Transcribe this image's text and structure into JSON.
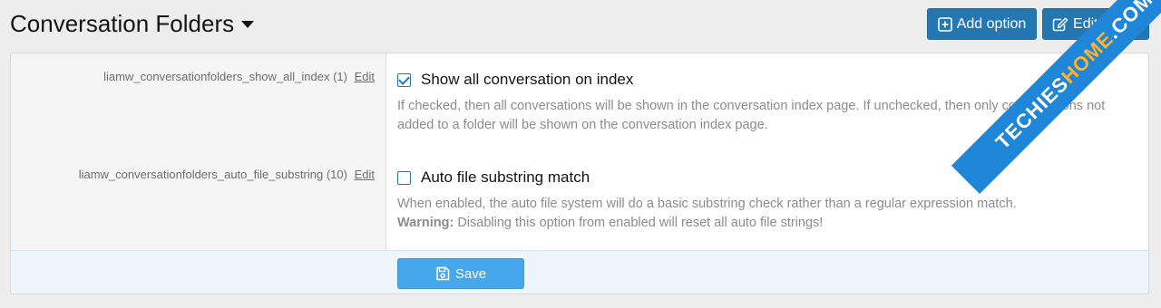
{
  "header": {
    "title": "Conversation Folders",
    "add_option_label": "Add option",
    "edit_group_label": "Edit group"
  },
  "options": [
    {
      "key": "liamw_conversationfolders_show_all_index (1)",
      "edit_label": "Edit",
      "checked": true,
      "title": "Show all conversation on index",
      "description": "If checked, then all conversations will be shown in the conversation index page. If unchecked, then only conversations not added to a folder will be shown on the conversation index page."
    },
    {
      "key": "liamw_conversationfolders_auto_file_substring (10)",
      "edit_label": "Edit",
      "checked": false,
      "title": "Auto file substring match",
      "description": "When enabled, the auto file system will do a basic substring check rather than a regular expression match.",
      "warning_label": "Warning:",
      "warning_text": "Disabling this option from enabled will reset all auto file strings!"
    }
  ],
  "footer": {
    "save_label": "Save"
  },
  "watermark": {
    "part1": "TECHIES",
    "part2": "HOME",
    "part3": ".COM"
  },
  "colors": {
    "primary_button": "#2577b1",
    "save_button": "#47a7eb",
    "footer_background": "#eef5fc"
  }
}
